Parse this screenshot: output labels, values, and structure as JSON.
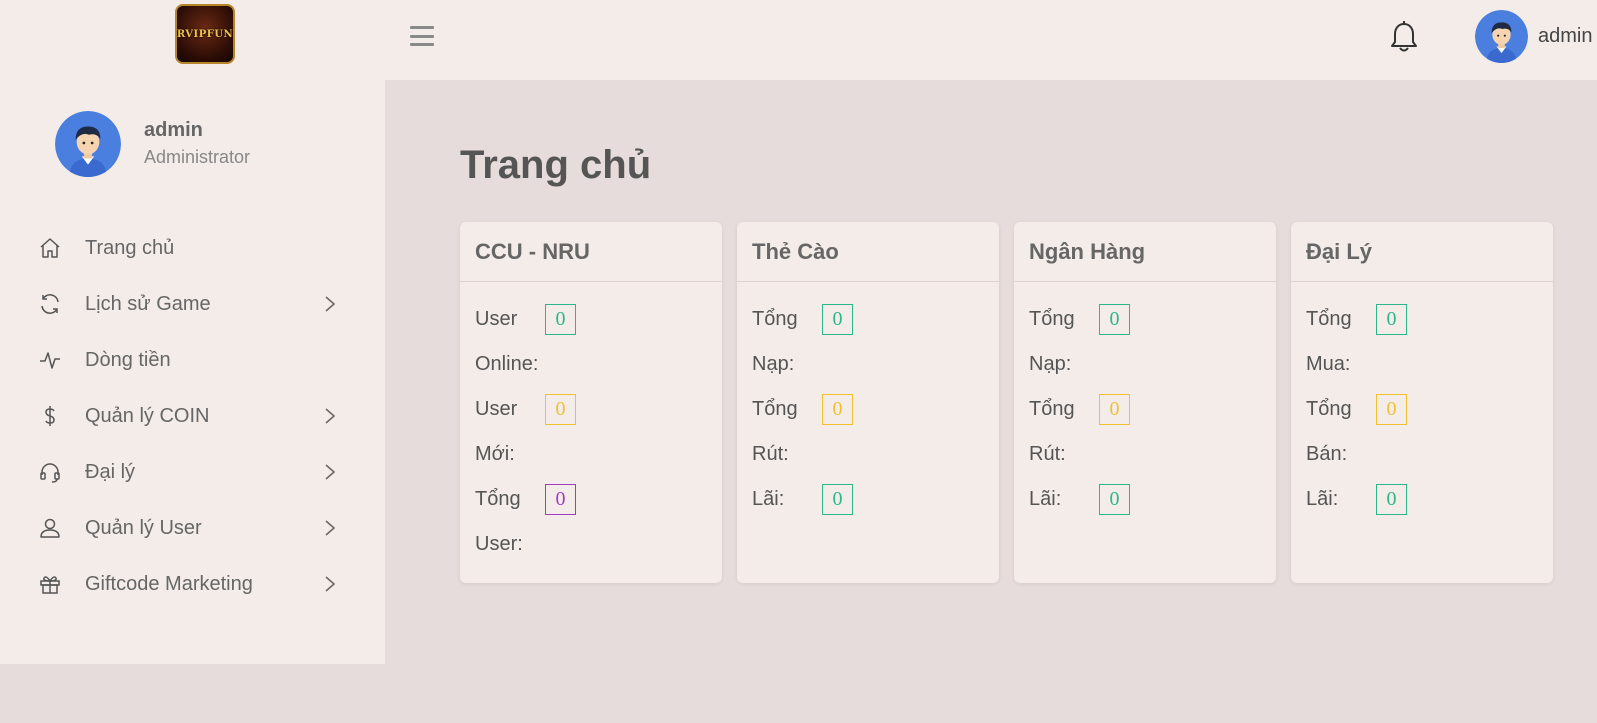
{
  "header": {
    "logo_text": "RVIPFUN",
    "user_name": "admin"
  },
  "sidebar": {
    "profile": {
      "name": "admin",
      "role": "Administrator"
    },
    "items": [
      {
        "label": "Trang chủ",
        "icon": "home-icon",
        "has_children": false
      },
      {
        "label": "Lịch sử Game",
        "icon": "refresh-icon",
        "has_children": true
      },
      {
        "label": "Dòng tiền",
        "icon": "pulse-icon",
        "has_children": false
      },
      {
        "label": "Quản lý COIN",
        "icon": "dollar-icon",
        "has_children": true
      },
      {
        "label": "Đại lý",
        "icon": "headset-icon",
        "has_children": true
      },
      {
        "label": "Quản lý User",
        "icon": "user-icon",
        "has_children": true
      },
      {
        "label": "Giftcode Marketing",
        "icon": "gift-icon",
        "has_children": true
      }
    ]
  },
  "main": {
    "title": "Trang chủ",
    "cards": [
      {
        "title": "CCU - NRU",
        "stats": [
          {
            "label_top": "User",
            "label_bottom": "Online:",
            "value": "0",
            "color": "green"
          },
          {
            "label_top": "User",
            "label_bottom": "Mới:",
            "value": "0",
            "color": "yellow"
          },
          {
            "label_top": "Tổng",
            "label_bottom": "User:",
            "value": "0",
            "color": "purple"
          }
        ]
      },
      {
        "title": "Thẻ Cào",
        "stats": [
          {
            "label_top": "Tổng",
            "label_bottom": "Nạp:",
            "value": "0",
            "color": "green"
          },
          {
            "label_top": "Tổng",
            "label_bottom": "Rút:",
            "value": "0",
            "color": "yellow"
          },
          {
            "label_top": "Lãi:",
            "label_bottom": "",
            "value": "0",
            "color": "green"
          }
        ]
      },
      {
        "title": "Ngân Hàng",
        "stats": [
          {
            "label_top": "Tổng",
            "label_bottom": "Nạp:",
            "value": "0",
            "color": "green"
          },
          {
            "label_top": "Tổng",
            "label_bottom": "Rút:",
            "value": "0",
            "color": "yellow"
          },
          {
            "label_top": "Lãi:",
            "label_bottom": "",
            "value": "0",
            "color": "green"
          }
        ]
      },
      {
        "title": "Đại Lý",
        "stats": [
          {
            "label_top": "Tổng",
            "label_bottom": "Mua:",
            "value": "0",
            "color": "green"
          },
          {
            "label_top": "Tổng",
            "label_bottom": "Bán:",
            "value": "0",
            "color": "yellow"
          },
          {
            "label_top": "Lãi:",
            "label_bottom": "",
            "value": "0",
            "color": "green"
          }
        ]
      }
    ]
  },
  "colors": {
    "green": "#2db68a",
    "yellow": "#f0c030",
    "purple": "#a23cc0",
    "avatar_bg": "#4a7fe0"
  }
}
